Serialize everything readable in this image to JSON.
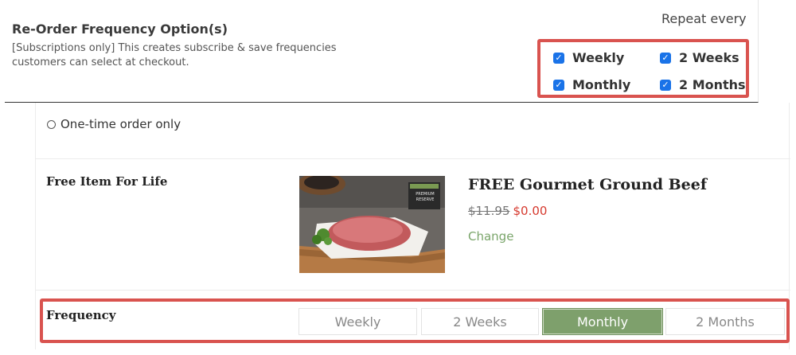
{
  "settings": {
    "title": "Re-Order Frequency Option(s)",
    "description": "[Subscriptions only] This creates subscribe & save frequencies customers can select at checkout.",
    "repeat_label": "Repeat every",
    "options": [
      {
        "label": "Weekly",
        "checked": true
      },
      {
        "label": "2 Weeks",
        "checked": true
      },
      {
        "label": "Monthly",
        "checked": true
      },
      {
        "label": "2 Months",
        "checked": true
      }
    ]
  },
  "order": {
    "onetime_label": "One-time order only"
  },
  "product": {
    "section_label": "Free Item For Life",
    "image_badge_lines": [
      "PREMIUM",
      "RESERVE"
    ],
    "title": "FREE Gourmet Ground Beef",
    "price_old": "$11.95",
    "price_new": "$0.00",
    "change_label": "Change"
  },
  "frequency": {
    "label": "Frequency",
    "options": [
      "Weekly",
      "2 Weeks",
      "Monthly",
      "2 Months"
    ],
    "selected": "Monthly"
  },
  "colors": {
    "highlight_border": "#d9534f",
    "checkbox_blue": "#1a73e8",
    "selected_green": "#7ea06c",
    "price_red": "#d63a2f",
    "link_green": "#7aa56a"
  }
}
